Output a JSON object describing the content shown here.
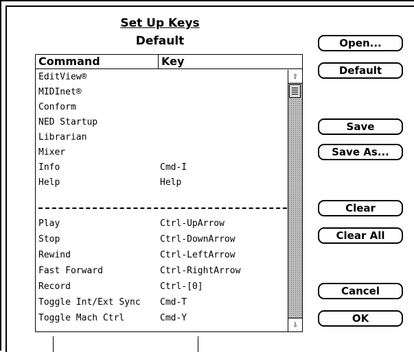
{
  "dialog": {
    "title": "Set Up Keys",
    "subtitle": "Default"
  },
  "table": {
    "headers": {
      "command": "Command",
      "key": "Key"
    },
    "rows_top": [
      {
        "command": "EditView®",
        "key": ""
      },
      {
        "command": "MIDInet®",
        "key": ""
      },
      {
        "command": "Conform",
        "key": ""
      },
      {
        "command": "NED Startup",
        "key": ""
      },
      {
        "command": "Librarian",
        "key": ""
      },
      {
        "command": "Mixer",
        "key": ""
      },
      {
        "command": "Info",
        "key": "Cmd-I"
      },
      {
        "command": "Help",
        "key": "Help"
      }
    ],
    "rows_bottom": [
      {
        "command": "Play",
        "key": "Ctrl-UpArrow"
      },
      {
        "command": "Stop",
        "key": "Ctrl-DownArrow"
      },
      {
        "command": "Rewind",
        "key": "Ctrl-LeftArrow"
      },
      {
        "command": "Fast Forward",
        "key": "Ctrl-RightArrow"
      },
      {
        "command": "Record",
        "key": "Ctrl-[0]"
      },
      {
        "command": "Toggle Int/Ext Sync",
        "key": "Cmd-T"
      },
      {
        "command": "Toggle Mach Ctrl",
        "key": "Cmd-Y"
      }
    ]
  },
  "scrollbar": {
    "up_icon": "up-arrow-icon",
    "down_icon": "down-arrow-icon",
    "up_glyph": "⇧",
    "down_glyph": "⇩"
  },
  "buttons": {
    "open": "Open...",
    "default": "Default",
    "save": "Save",
    "save_as": "Save As...",
    "clear": "Clear",
    "clear_all": "Clear All",
    "cancel": "Cancel",
    "ok": "OK"
  }
}
